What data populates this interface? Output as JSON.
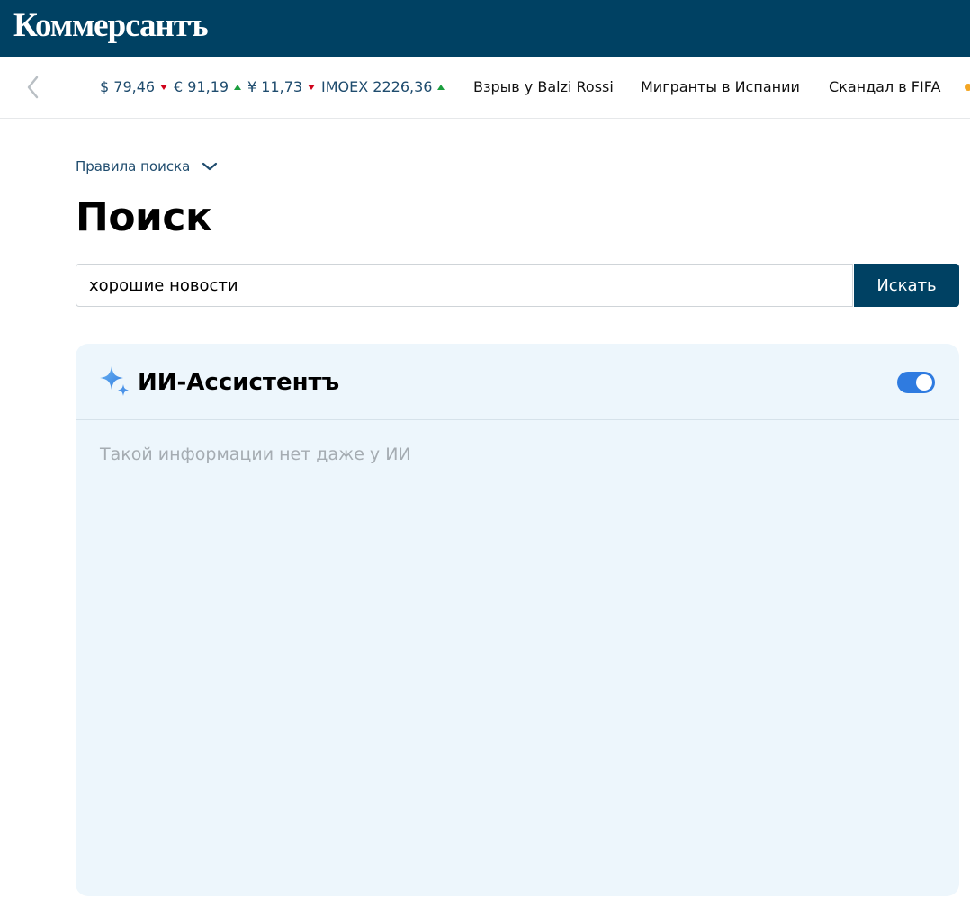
{
  "header": {
    "logo_text": "Коммерсантъ",
    "background_color": "#004163"
  },
  "ticker": {
    "prev_icon": "chevron-left-icon",
    "quotes": [
      {
        "label": "$ 79,46",
        "trend": "down"
      },
      {
        "label": "€ 91,19",
        "trend": "up"
      },
      {
        "label": "¥ 11,73",
        "trend": "down"
      },
      {
        "label": "IMOEX 2226,36",
        "trend": "up"
      }
    ],
    "news": [
      {
        "label": "Взрыв у Balzi Rossi"
      },
      {
        "label": "Мигранты в Испании"
      },
      {
        "label": "Скандал в FIFA"
      }
    ],
    "trend_colors": {
      "down": "#d0021b",
      "up": "#1b9e3e"
    }
  },
  "search": {
    "rules_label": "Правила поиска",
    "rules_icon": "chevron-down-icon",
    "title": "Поиск",
    "query_value": "хорошие новости",
    "button_label": "Искать"
  },
  "ai_assistant": {
    "icon": "sparkle-icon",
    "title": "ИИ-Ассистентъ",
    "toggle_on": true,
    "message": "Такой информации нет даже у ИИ",
    "panel_color": "#edf6fc",
    "accent_color": "#2f7be0"
  }
}
